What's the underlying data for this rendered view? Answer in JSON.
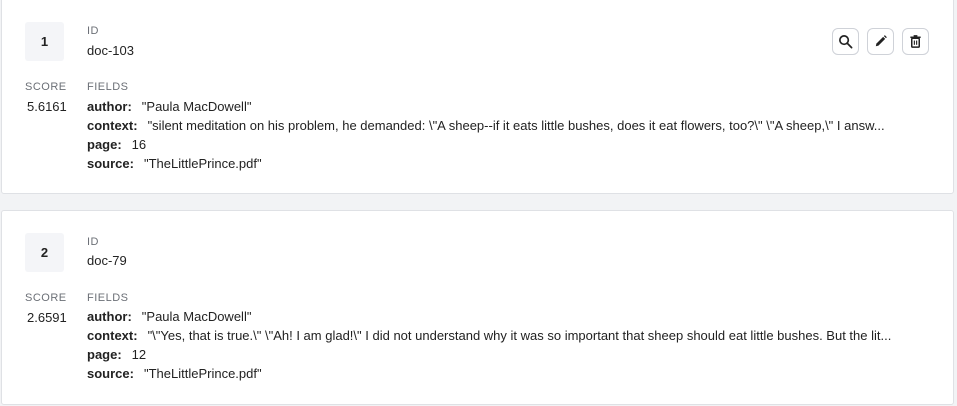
{
  "results": [
    {
      "rank": "1",
      "id_label": "ID",
      "id": "doc-103",
      "score_label": "SCORE",
      "score": "5.6161",
      "fields_label": "FIELDS",
      "fields": [
        {
          "key": "author:",
          "value": "\"Paula MacDowell\""
        },
        {
          "key": "context:",
          "value": "\"silent meditation on his problem, he demanded: \\\"A sheep--if it eats little bushes, does it eat flowers, too?\\\" \\\"A sheep,\\\" I answ..."
        },
        {
          "key": "page:",
          "value": "16"
        },
        {
          "key": "source:",
          "value": "\"TheLittlePrince.pdf\""
        }
      ],
      "actions": [
        "search-icon",
        "pencil-icon",
        "trash-icon"
      ]
    },
    {
      "rank": "2",
      "id_label": "ID",
      "id": "doc-79",
      "score_label": "SCORE",
      "score": "2.6591",
      "fields_label": "FIELDS",
      "fields": [
        {
          "key": "author:",
          "value": "\"Paula MacDowell\""
        },
        {
          "key": "context:",
          "value": "\"\\\"Yes, that is true.\\\" \\\"Ah! I am glad!\\\" I did not understand why it was so important that sheep should eat little bushes. But the lit..."
        },
        {
          "key": "page:",
          "value": "12"
        },
        {
          "key": "source:",
          "value": "\"TheLittlePrince.pdf\""
        }
      ]
    }
  ]
}
